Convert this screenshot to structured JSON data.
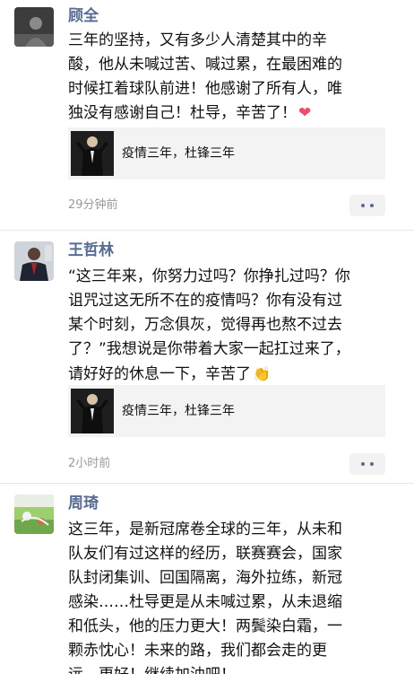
{
  "posts": [
    {
      "author": "顾全",
      "text": "三年的坚持，又有多少人清楚其中的辛\n酸，他从未喊过苦、喊过累，在最困难的\n时候扛着球队前进！他感谢了所有人，唯\n独没有感谢自己！杜导，辛苦了！",
      "emoji": "heart-emoji",
      "link_title": "疫情三年，杜锋三年",
      "time": "29分钟前"
    },
    {
      "author": "王哲林",
      "text": "“这三年来，你努力过吗？你挣扎过吗？你\n诅咒过这无所不在的疫情吗？你有没有过\n某个时刻，万念俱灰，觉得再也熬不过去\n了？”我想说是你带着大家一起扛过来了，\n请好好的休息一下，辛苦了",
      "emoji": "clapping-hands-emoji",
      "link_title": "疫情三年，杜锋三年",
      "time": "2小时前"
    },
    {
      "author": "周琦",
      "text": "这三年，是新冠席卷全球的三年，从未和\n队友们有过这样的经历，联赛赛会，国家\n队封闭集训、回国隔离，海外拉练，新冠\n感染……杜导更是从未喊过累，从未退缩\n和低头，他的压力更大！两鬓染白霜，一\n颗赤忱心！未来的路，我们都会走的更\n远，更好！继续加油吧！"
    }
  ],
  "colors": {
    "name": "#576b95",
    "time": "#9a9a9a",
    "card_bg": "#f3f3f3",
    "divider": "#e6e6e6"
  }
}
